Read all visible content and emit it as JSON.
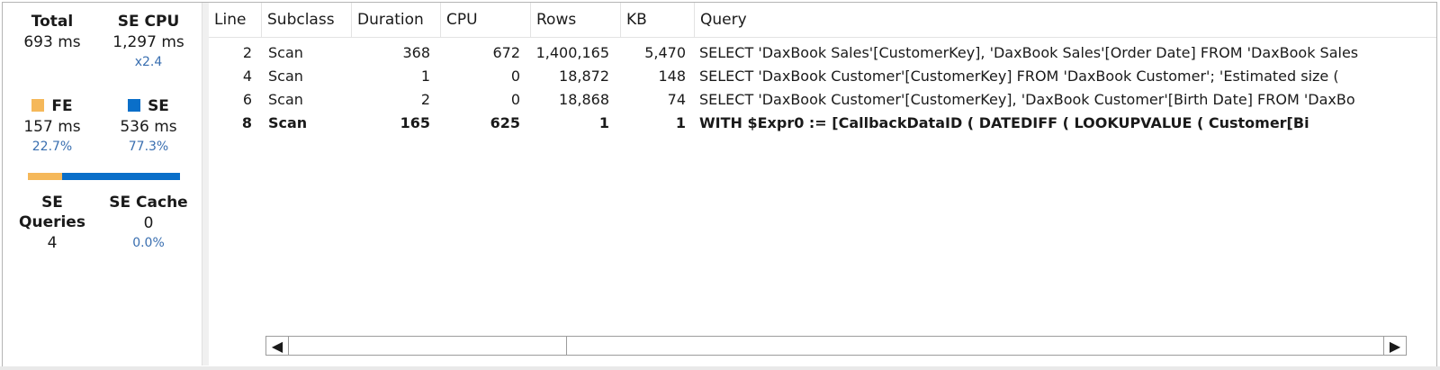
{
  "summary": {
    "total_label": "Total",
    "total_value": "693 ms",
    "se_cpu_label": "SE CPU",
    "se_cpu_value": "1,297 ms",
    "se_cpu_ratio": "x2.4",
    "fe_label": "FE",
    "fe_value": "157 ms",
    "fe_pct": "22.7%",
    "se_label": "SE",
    "se_value": "536 ms",
    "se_pct": "77.3%",
    "fe_fraction": 0.227,
    "se_queries_label": "SE Queries",
    "se_queries_value": "4",
    "se_cache_label": "SE Cache",
    "se_cache_value": "0",
    "se_cache_pct": "0.0%"
  },
  "colors": {
    "fe": "#f5b85a",
    "se": "#0a6fc9",
    "link_blue": "#3a6fb0"
  },
  "grid": {
    "columns": [
      "Line",
      "Subclass",
      "Duration",
      "CPU",
      "Rows",
      "KB",
      "Query"
    ],
    "rows": [
      {
        "line": "2",
        "subclass": "Scan",
        "duration": "368",
        "cpu": "672",
        "rows": "1,400,165",
        "kb": "5,470",
        "query": "SELECT 'DaxBook Sales'[CustomerKey], 'DaxBook Sales'[Order Date] FROM 'DaxBook Sales",
        "bold": false
      },
      {
        "line": "4",
        "subclass": "Scan",
        "duration": "1",
        "cpu": "0",
        "rows": "18,872",
        "kb": "148",
        "query": "SELECT 'DaxBook Customer'[CustomerKey] FROM 'DaxBook Customer';   'Estimated size (",
        "bold": false
      },
      {
        "line": "6",
        "subclass": "Scan",
        "duration": "2",
        "cpu": "0",
        "rows": "18,868",
        "kb": "74",
        "query": "SELECT 'DaxBook Customer'[CustomerKey], 'DaxBook Customer'[Birth Date] FROM 'DaxBo",
        "bold": false
      },
      {
        "line": "8",
        "subclass": "Scan",
        "duration": "165",
        "cpu": "625",
        "rows": "1",
        "kb": "1",
        "query": "WITH $Expr0 := [CallbackDataID ( DATEDIFF (            LOOKUPVALUE ( Customer[Bi",
        "bold": true
      }
    ]
  },
  "scrollbar": {
    "left_arrow": "◀",
    "right_arrow": "▶"
  }
}
